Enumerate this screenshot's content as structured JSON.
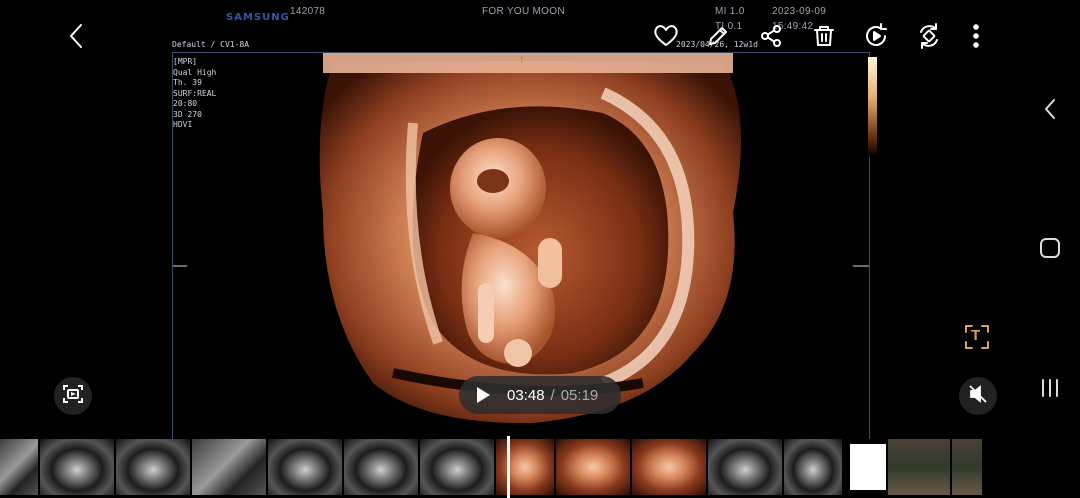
{
  "header": {
    "brand": "SAMSUNG",
    "patient_id": "142078",
    "patient_name": "FOR YOU MOON",
    "preset": "Default / CV1-8A",
    "mi": "MI  1.0",
    "ti": "TI  0.1",
    "date": "2023-09-09",
    "time": "15:49:42",
    "exam_date": "2023/04/26, 12w1d"
  },
  "scan_params": [
    "[MPR]",
    "Qual High",
    "Th. 39",
    "SURF:REAL",
    "20:80",
    "3D 270",
    "HDVI"
  ],
  "toolbar": {
    "back": "back-arrow-icon",
    "icons": [
      "heart-icon",
      "pencil-icon",
      "share-icon",
      "trash-icon",
      "replay-icon",
      "rotate-icon",
      "more-vert-icon"
    ]
  },
  "player": {
    "current": "03:48",
    "separator": "/",
    "duration": "05:19"
  },
  "side": {
    "text_recognize": "T"
  },
  "colors": {
    "accent": "#e0a24a",
    "scan_border": "#3a4a6a",
    "brand": "#2f5aa8"
  },
  "thumbnails": [
    {
      "type": "gray",
      "w": 38
    },
    {
      "type": "dark",
      "w": 74
    },
    {
      "type": "dark",
      "w": 74
    },
    {
      "type": "gray",
      "w": 74
    },
    {
      "type": "dark",
      "w": 74
    },
    {
      "type": "dark",
      "w": 74
    },
    {
      "type": "dark",
      "w": 74
    },
    {
      "type": "orange",
      "w": 58
    },
    {
      "type": "orange",
      "w": 74
    },
    {
      "type": "orange",
      "w": 74
    },
    {
      "type": "dark",
      "w": 74
    },
    {
      "type": "dark",
      "w": 58
    },
    {
      "type": "white",
      "w": 36
    },
    {
      "type": "photo",
      "w": 62
    },
    {
      "type": "photo",
      "w": 30
    }
  ]
}
